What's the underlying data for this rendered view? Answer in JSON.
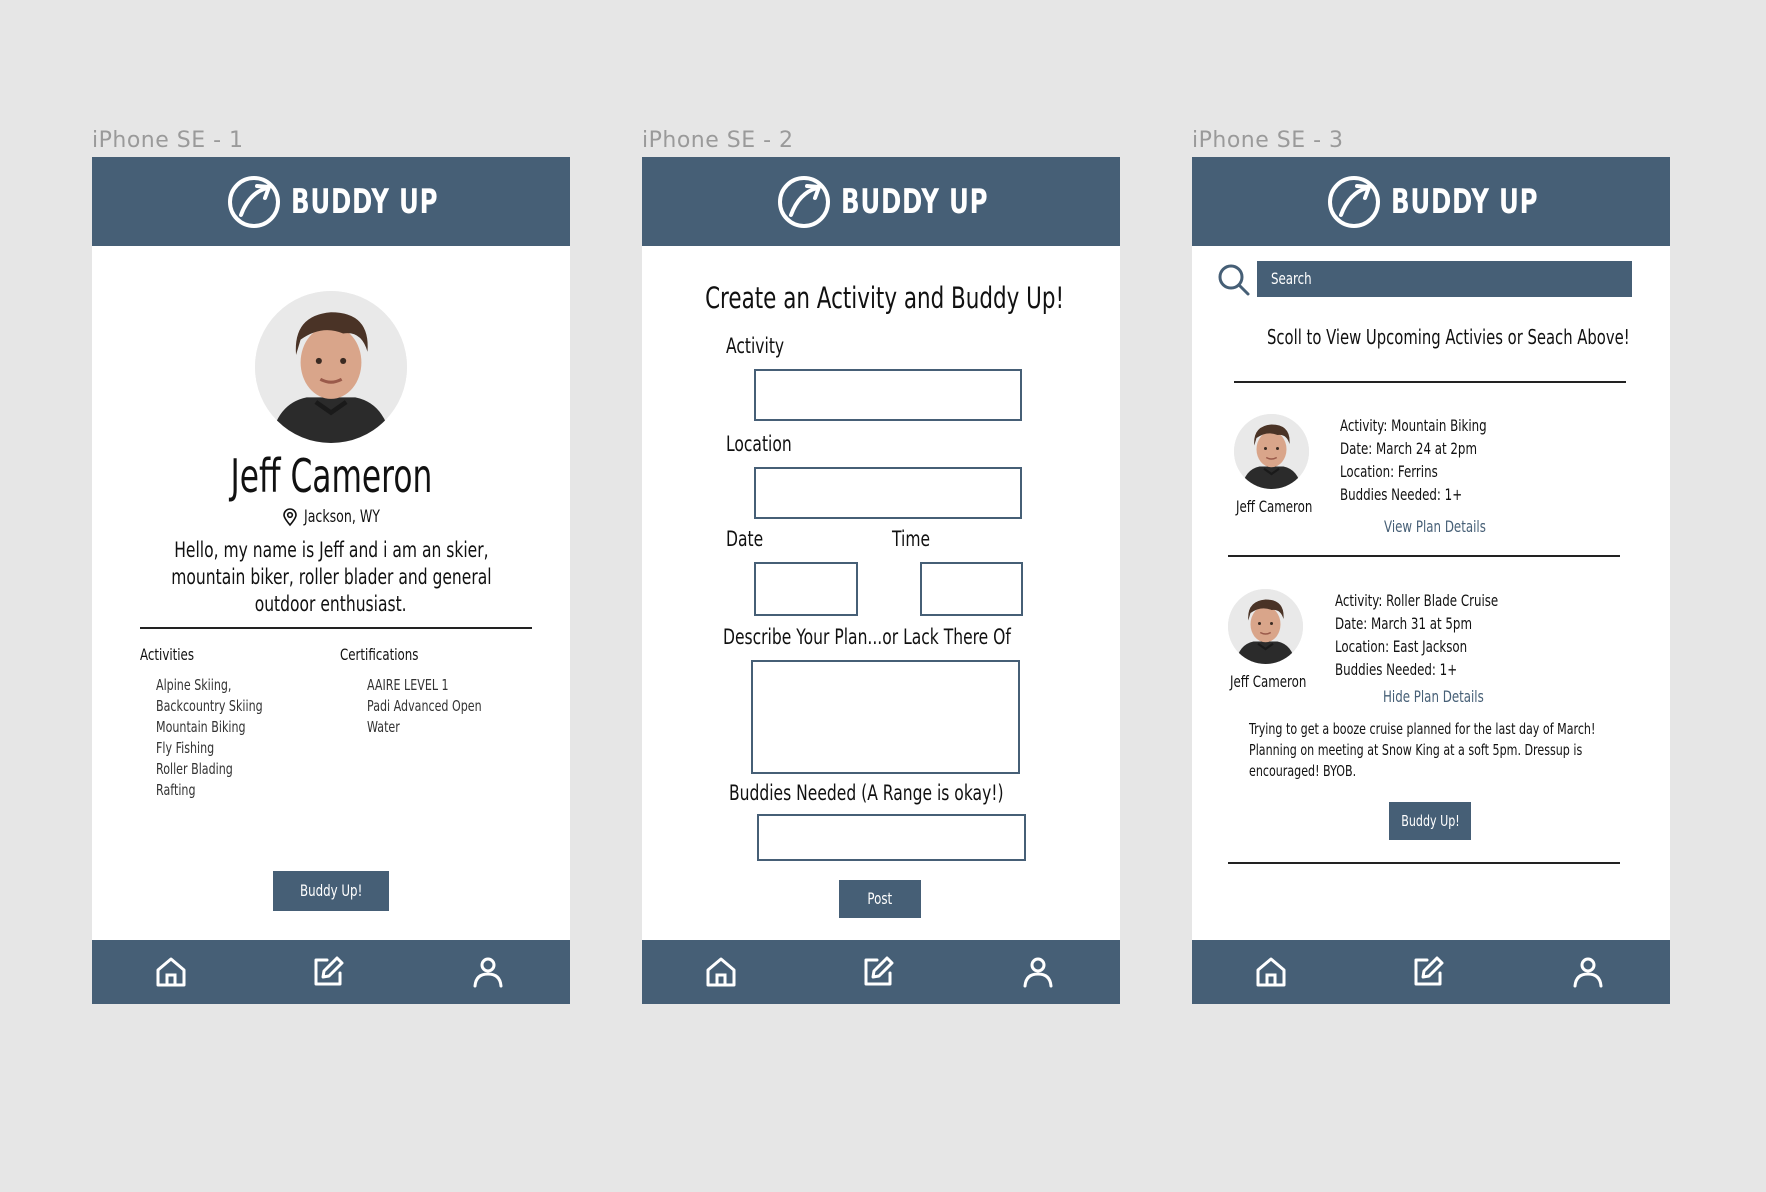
{
  "frames": [
    {
      "label": "iPhone SE - 1"
    },
    {
      "label": "iPhone SE - 2"
    },
    {
      "label": "iPhone SE - 3"
    }
  ],
  "brand": {
    "name": "BUDDY UP",
    "color": "#465f76",
    "logo_icon": "arrow-circle-logo-icon"
  },
  "nav": {
    "home_icon": "home-icon",
    "post_icon": "edit-icon",
    "profile_icon": "user-icon"
  },
  "profile": {
    "name": "Jeff Cameron",
    "location": "Jackson, WY",
    "bio_lines": [
      "Hello, my name is Jeff and i am an skier,",
      "mountain biker, roller blader and general",
      "outdoor enthusiast."
    ],
    "activities_heading": "Activities",
    "activities": [
      "Alpine Skiing,",
      "Backcountry Skiing",
      "Mountain Biking",
      "Fly Fishing",
      "Roller Blading",
      "Rafting"
    ],
    "certifications_heading": "Certifications",
    "certifications": [
      "AAIRE LEVEL 1",
      "Padi Advanced Open",
      "Water"
    ],
    "button": "Buddy Up!"
  },
  "create": {
    "title": "Create an Activity and Buddy Up!",
    "activity_label": "Activity",
    "location_label": "Location",
    "date_label": "Date",
    "time_label": "Time",
    "describe_label": "Describe Your Plan...or Lack There Of",
    "buddies_label": "Buddies Needed (A Range is okay!)",
    "post_button": "Post"
  },
  "feed": {
    "search_placeholder": "Search",
    "subtitle": "Scoll to View Upcoming Activies or Seach Above!",
    "posts": [
      {
        "user": "Jeff Cameron",
        "activity": "Activity: Mountain Biking",
        "date": "Date: March 24 at 2pm",
        "location": "Location: Ferrins",
        "buddies": "Buddies Needed: 1+",
        "toggle": "View Plan Details"
      },
      {
        "user": "Jeff Cameron",
        "activity": "Activity: Roller Blade Cruise",
        "date": "Date: March 31 at 5pm",
        "location": "Location: East Jackson",
        "buddies": "Buddies Needed: 1+",
        "toggle": "Hide Plan Details",
        "details_lines": [
          "Trying to get a booze cruise planned for the last day of March!",
          "Planning on meeting at Snow King at a soft 5pm. Dressup is",
          "encouraged! BYOB."
        ],
        "button": "Buddy Up!"
      }
    ]
  }
}
